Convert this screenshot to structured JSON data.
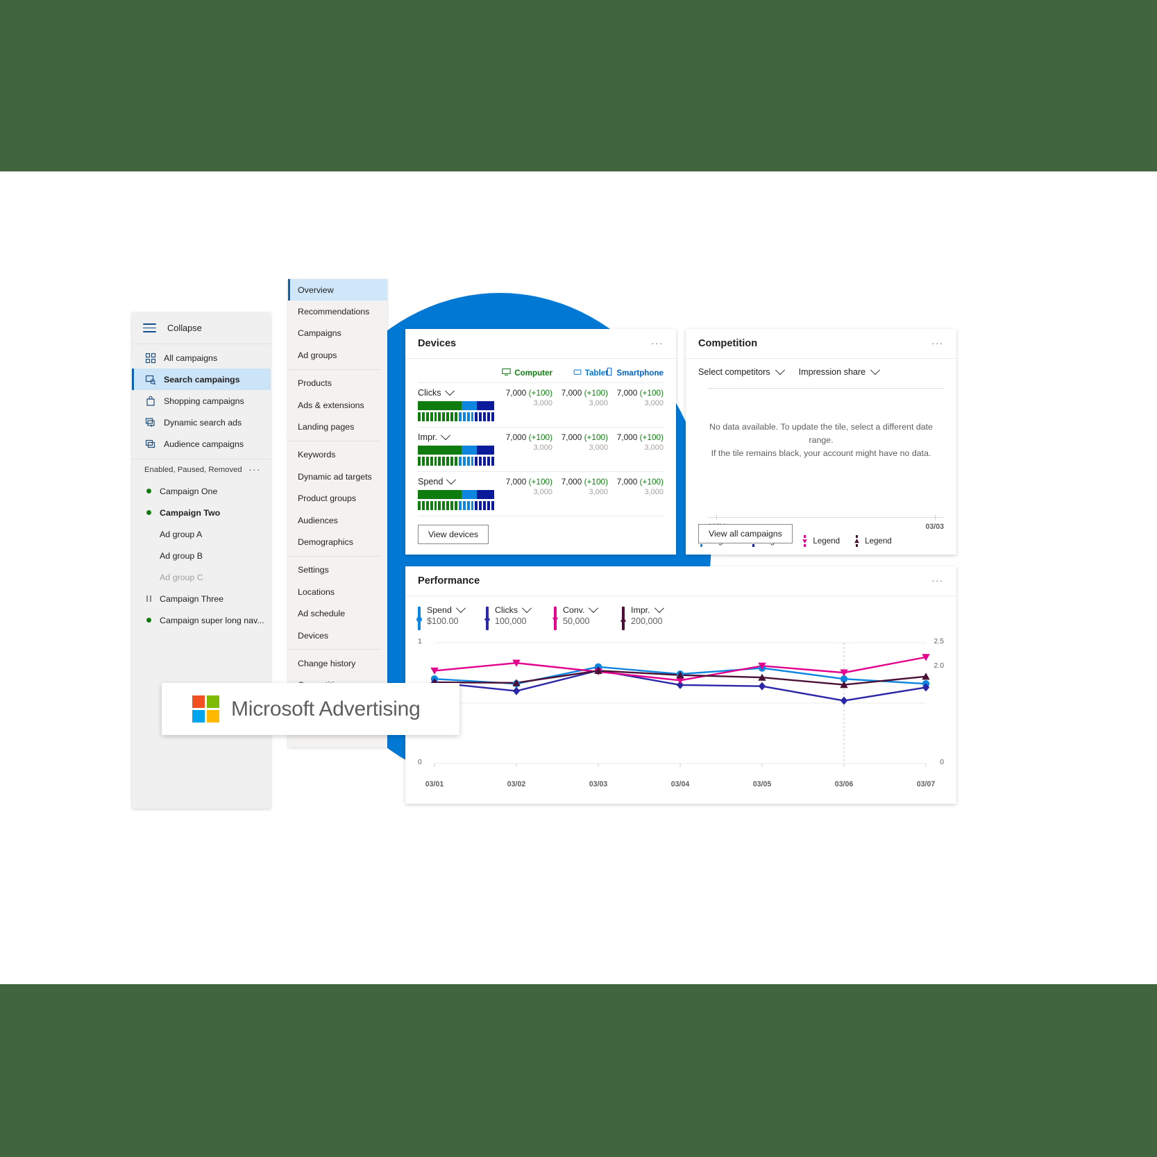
{
  "theme": {
    "band_color": "#41663F",
    "accent_blue": "#0078D4",
    "selected_nav_blue": "#CCE4F7",
    "green": "#107C10"
  },
  "sidebar": {
    "collapse_label": "Collapse",
    "nav_items": [
      {
        "label": "All campaigns",
        "icon": "grid-icon",
        "selected": false
      },
      {
        "label": "Search campaings",
        "icon": "search-campaign-icon",
        "selected": true
      },
      {
        "label": "Shopping campaigns",
        "icon": "bag-icon",
        "selected": false
      },
      {
        "label": "Dynamic search ads",
        "icon": "dynamic-search-icon",
        "selected": false
      },
      {
        "label": "Audience campaigns",
        "icon": "audience-icon",
        "selected": false
      }
    ],
    "filter_label": "Enabled, Paused, Removed",
    "filter_more": "···",
    "campaigns": [
      {
        "label": "Campaign One",
        "status": "enabled",
        "bold": false,
        "type": "campaign"
      },
      {
        "label": "Campaign Two",
        "status": "enabled",
        "bold": true,
        "type": "campaign"
      },
      {
        "label": "Ad group A",
        "status": "none",
        "bold": false,
        "type": "adgroup",
        "dim": false
      },
      {
        "label": "Ad group B",
        "status": "none",
        "bold": false,
        "type": "adgroup",
        "dim": false
      },
      {
        "label": "Ad group C",
        "status": "none",
        "bold": false,
        "type": "adgroup",
        "dim": true
      },
      {
        "label": "Campaign Three",
        "status": "paused",
        "bold": false,
        "type": "campaign"
      },
      {
        "label": "Campaign super long nav...",
        "status": "enabled",
        "bold": false,
        "type": "campaign"
      }
    ]
  },
  "subnav": {
    "items": [
      {
        "label": "Overview",
        "selected": true,
        "sep_after": false
      },
      {
        "label": "Recommendations",
        "selected": false,
        "sep_after": false
      },
      {
        "label": "Campaigns",
        "selected": false,
        "sep_after": false
      },
      {
        "label": "Ad groups",
        "selected": false,
        "sep_after": true
      },
      {
        "label": "Products",
        "selected": false,
        "sep_after": false
      },
      {
        "label": "Ads & extensions",
        "selected": false,
        "sep_after": false
      },
      {
        "label": "Landing pages",
        "selected": false,
        "sep_after": true
      },
      {
        "label": "Keywords",
        "selected": false,
        "sep_after": false
      },
      {
        "label": "Dynamic ad targets",
        "selected": false,
        "sep_after": false
      },
      {
        "label": "Product groups",
        "selected": false,
        "sep_after": false
      },
      {
        "label": "Audiences",
        "selected": false,
        "sep_after": false
      },
      {
        "label": "Demographics",
        "selected": false,
        "sep_after": true
      },
      {
        "label": "Settings",
        "selected": false,
        "sep_after": false
      },
      {
        "label": "Locations",
        "selected": false,
        "sep_after": false
      },
      {
        "label": "Ad schedule",
        "selected": false,
        "sep_after": false
      },
      {
        "label": "Devices",
        "selected": false,
        "sep_after": true
      },
      {
        "label": "Change history",
        "selected": false,
        "sep_after": false
      },
      {
        "label": "Competition",
        "selected": false,
        "sep_after": false
      }
    ]
  },
  "devices_card": {
    "title": "Devices",
    "more": "···",
    "columns": [
      {
        "label": "Computer",
        "icon": "monitor-icon",
        "color": "#107C10"
      },
      {
        "label": "Tablet",
        "icon": "tablet-icon",
        "color": "#0078D4"
      },
      {
        "label": "Smartphone",
        "icon": "phone-icon",
        "color": "#0062C4"
      }
    ],
    "rows": [
      {
        "metric": "Clicks",
        "split": [
          57,
          20,
          23
        ],
        "cells": [
          {
            "value": "7,000",
            "delta": "(+100)",
            "sub": "3,000"
          },
          {
            "value": "7,000",
            "delta": "(+100)",
            "sub": "3,000"
          },
          {
            "value": "7,000",
            "delta": "(+100)",
            "sub": "3,000"
          }
        ]
      },
      {
        "metric": "Impr.",
        "split": [
          57,
          20,
          23
        ],
        "cells": [
          {
            "value": "7,000",
            "delta": "(+100)",
            "sub": "3,000"
          },
          {
            "value": "7,000",
            "delta": "(+100)",
            "sub": "3,000"
          },
          {
            "value": "7,000",
            "delta": "(+100)",
            "sub": "3,000"
          }
        ]
      },
      {
        "metric": "Spend",
        "split": [
          57,
          20,
          23
        ],
        "cells": [
          {
            "value": "7,000",
            "delta": "(+100)",
            "sub": "3,000"
          },
          {
            "value": "7,000",
            "delta": "(+100)",
            "sub": "3,000"
          },
          {
            "value": "7,000",
            "delta": "(+100)",
            "sub": "3,000"
          }
        ]
      }
    ],
    "button_label": "View devices"
  },
  "competition_card": {
    "title": "Competition",
    "more": "···",
    "select_competitors_label": "Select competitors",
    "metric_label": "Impression share",
    "empty_message_line1": "No data available. To update the tile, select a different date range.",
    "empty_message_line2": "If the tile remains black, your account might have no data.",
    "axis_start": "03/01",
    "axis_end": "03/03",
    "legend": [
      {
        "label": "Legend",
        "color": "#0E86E0",
        "marker": "circle"
      },
      {
        "label": "Legend",
        "color": "#0B199B",
        "marker": "diamond"
      },
      {
        "label": "Legend",
        "color": "#E3008C",
        "marker": "triangle-down"
      },
      {
        "label": "Legend",
        "color": "#4A1036",
        "marker": "triangle-up"
      }
    ],
    "button_label": "View all campaigns"
  },
  "performance_card": {
    "title": "Performance",
    "more": "···",
    "metrics": [
      {
        "label": "Spend",
        "value": "$100.00",
        "color": "#0E86E0"
      },
      {
        "label": "Clicks",
        "value": "100,000",
        "color": "#2B27A8"
      },
      {
        "label": "Conv.",
        "value": "50,000",
        "color": "#E3008C"
      },
      {
        "label": "Impr.",
        "value": "200,000",
        "color": "#4A1036"
      }
    ]
  },
  "chart_data": {
    "type": "line",
    "title": "Performance",
    "x": [
      "03/01",
      "03/02",
      "03/03",
      "03/04",
      "03/05",
      "03/06",
      "03/07"
    ],
    "xlabel": "",
    "ylabel_left": "",
    "ylabel_right": "",
    "left_axis_ticks": [
      "1",
      "0"
    ],
    "left_ylim": [
      0,
      1
    ],
    "right_axis_ticks": [
      "2.5",
      "2.0",
      "0"
    ],
    "right_ylim": [
      0,
      2.5
    ],
    "grid": true,
    "legend_position": "top",
    "highlight_x": "03/06",
    "series": [
      {
        "name": "Spend",
        "color": "#0E86E0",
        "marker": "circle",
        "axis": "left",
        "values": [
          0.7,
          0.66,
          0.8,
          0.74,
          0.79,
          0.7,
          0.66
        ]
      },
      {
        "name": "Clicks",
        "color": "#2B27A8",
        "marker": "diamond",
        "axis": "left",
        "values": [
          0.67,
          0.6,
          0.77,
          0.65,
          0.64,
          0.52,
          0.63
        ]
      },
      {
        "name": "Conv.",
        "color": "#E3008C",
        "marker": "triangle-down",
        "axis": "right",
        "values": [
          1.92,
          2.08,
          1.9,
          1.72,
          2.02,
          1.88,
          2.2
        ]
      },
      {
        "name": "Impr.",
        "color": "#4A1036",
        "marker": "triangle-up",
        "axis": "right",
        "values": [
          1.68,
          1.67,
          1.92,
          1.83,
          1.78,
          1.63,
          1.8
        ]
      }
    ]
  },
  "brand_card": {
    "name": "Microsoft Advertising",
    "logo_colors": [
      "#F25022",
      "#7FBA00",
      "#00A4EF",
      "#FFB900"
    ]
  }
}
